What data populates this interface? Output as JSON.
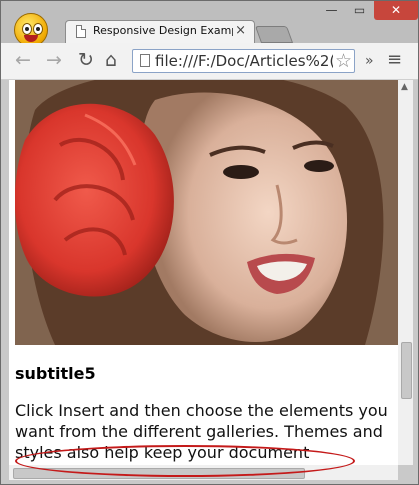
{
  "tab": {
    "title": "Responsive Design Examp",
    "close": "×"
  },
  "window": {
    "minimize": "—",
    "maximize": "▭",
    "close": "✕"
  },
  "toolbar": {
    "back": "←",
    "forward": "→",
    "reload": "↻",
    "home": "⌂",
    "url": "file:///F:/Doc/Articles%2(",
    "star": "☆",
    "overflow": "»",
    "menu": "≡"
  },
  "content": {
    "subtitle": "subtitle5",
    "paragraph": "Click Insert and then choose the elements you want from the different galleries. Themes and styles also help keep your document coordinated."
  },
  "colors": {
    "annotation": "#c41a1a",
    "flower": "#d9362c",
    "close_button": "#c7463c"
  }
}
